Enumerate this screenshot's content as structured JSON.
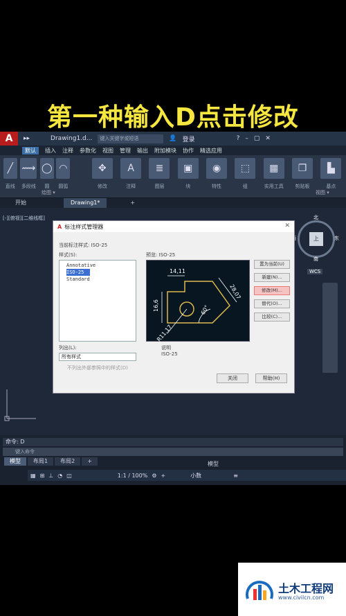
{
  "caption": "第一种输入D点击修改",
  "titlebar": {
    "logo": "A",
    "expand": "▸▸",
    "filename": "Drawing1.d...",
    "search_placeholder": "键入关键字或短语",
    "user": "登录"
  },
  "menu": [
    "默认",
    "插入",
    "注释",
    "参数化",
    "视图",
    "管理",
    "输出",
    "附加模块",
    "协作",
    "精选应用"
  ],
  "ribbon": {
    "groups": [
      {
        "label": "直线",
        "icon": "╱"
      },
      {
        "label": "多段线",
        "icon": "⟿"
      },
      {
        "label": "圆",
        "icon": "◯"
      },
      {
        "label": "圆弧",
        "icon": "◠"
      },
      {
        "label": "修改",
        "icon": "✥"
      },
      {
        "label": "注释",
        "icon": "A"
      },
      {
        "label": "图层",
        "icon": "≣"
      },
      {
        "label": "块",
        "icon": "▣"
      },
      {
        "label": "特性",
        "icon": "◉"
      },
      {
        "label": "组",
        "icon": "⬚"
      },
      {
        "label": "实用工具",
        "icon": "▦"
      },
      {
        "label": "剪贴板",
        "icon": "❐"
      },
      {
        "label": "基点",
        "icon": "▙"
      }
    ],
    "footer_left": "绘图 ▾",
    "footer_right": "视图 ▾"
  },
  "tabs": [
    "开始",
    "Drawing1*",
    "+"
  ],
  "viewport_label": "[-][俯视][二维线框]",
  "compass": {
    "n": "北",
    "s": "南",
    "e": "东",
    "w": "西",
    "center": "上",
    "wcs": "WCS"
  },
  "dialog": {
    "title": "标注样式管理器",
    "current_style": "当前标注样式: ISO-25",
    "styles_label": "样式(S):",
    "styles": [
      "Annotative",
      "ISO-25",
      "Standard"
    ],
    "selected_style": "ISO-25",
    "preview_label": "预览: ISO-25",
    "list_label": "列出(L):",
    "list_value": "所有样式",
    "checkbox": "不列出外部参照中的样式(D)",
    "desc_label": "说明",
    "desc_value": "ISO-25",
    "buttons": [
      "置为当前(U)",
      "新建(N)...",
      "修改(M)...",
      "替代(O)...",
      "比较(C)..."
    ],
    "close": "关闭",
    "help": "帮助(H)",
    "preview_dims": {
      "top": "14,11",
      "left": "16,6",
      "right": "28,07",
      "angle": "60°",
      "radius": "R11,17"
    }
  },
  "command": {
    "history": "命令: D",
    "placeholder": "键入命令"
  },
  "layouts": [
    "模型",
    "布局1",
    "布局2",
    "+"
  ],
  "status": {
    "model": "模型",
    "scale": "1:1 / 100%",
    "units": "小数"
  },
  "watermark": {
    "title": "土木工程网",
    "url": "www.civilcn.com"
  },
  "colors": {
    "caption": "#f6e640",
    "accent": "#3a6ea5",
    "highlight": "#f6c3c3"
  }
}
